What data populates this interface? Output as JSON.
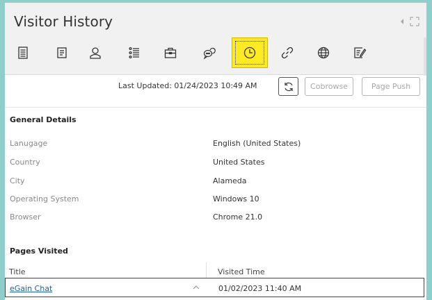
{
  "header": {
    "title": "Visitor History"
  },
  "tabs": [
    {
      "icon": "document-icon"
    },
    {
      "icon": "notes-icon"
    },
    {
      "icon": "user-icon"
    },
    {
      "icon": "list-icon"
    },
    {
      "icon": "briefcase-icon"
    },
    {
      "icon": "chat-icon"
    },
    {
      "icon": "clock-icon",
      "active": true
    },
    {
      "icon": "link-icon"
    },
    {
      "icon": "globe-icon"
    },
    {
      "icon": "edit-note-icon"
    }
  ],
  "toolbar": {
    "last_updated": "Last Updated: 01/24/2023 10:49 AM",
    "cobrowse_label": "Cobrowse",
    "page_push_label": "Page Push"
  },
  "general": {
    "title": "General Details",
    "rows": [
      {
        "label": "Lanugage",
        "value": "English (United States)"
      },
      {
        "label": "Country",
        "value": "United States"
      },
      {
        "label": "City",
        "value": "Alameda"
      },
      {
        "label": "Operating System",
        "value": "Windows 10"
      },
      {
        "label": "Browser",
        "value": "Chrome 21.0"
      }
    ]
  },
  "pages": {
    "title": "Pages Visited",
    "columns": {
      "title": "Title",
      "time": "Visited Time"
    },
    "rows": [
      {
        "title": "eGain Chat",
        "time": "01/02/2023 11:40 AM"
      }
    ]
  },
  "colors": {
    "active_tab": "#ffeb1f",
    "link": "#1a5fb4",
    "background": "#8fcfcb"
  }
}
